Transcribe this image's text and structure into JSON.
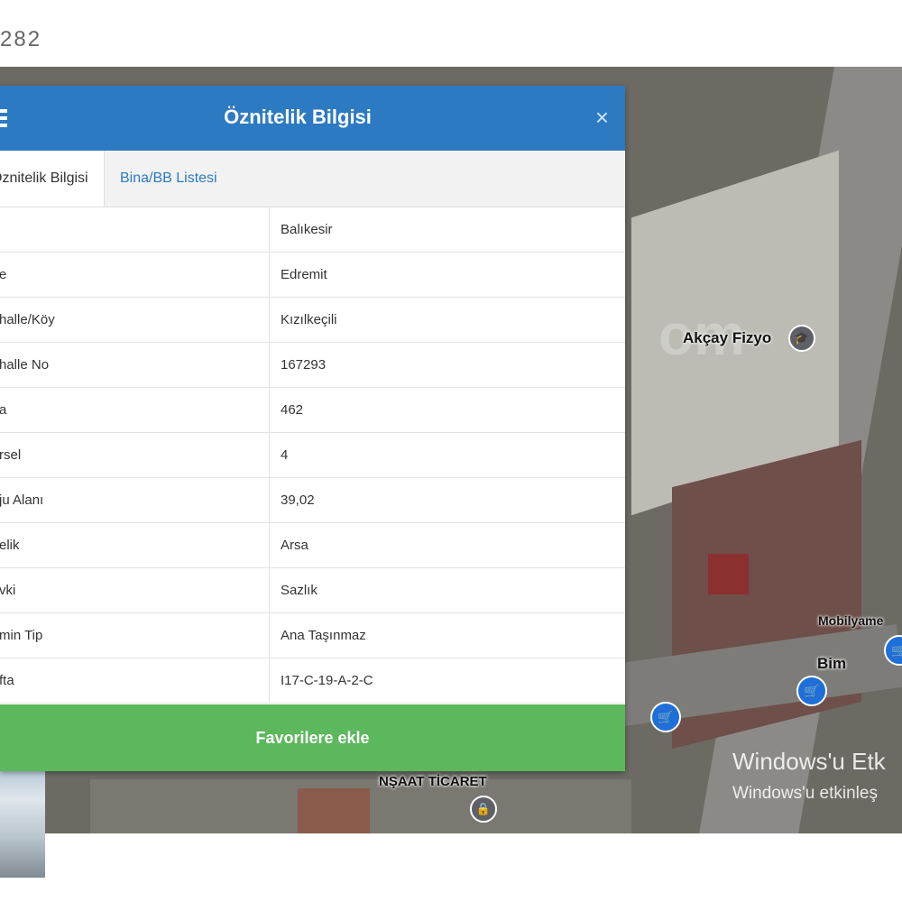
{
  "page": {
    "top_number": "282"
  },
  "dialog": {
    "title": "Öznitelik Bilgisi",
    "close_symbol": "×",
    "tabs": [
      {
        "label": "Öznitelik Bilgisi",
        "active": true
      },
      {
        "label": "Bina/BB Listesi",
        "active": false
      }
    ],
    "rows": [
      {
        "key": "",
        "value": "Balıkesir"
      },
      {
        "key": "e",
        "value": "Edremit"
      },
      {
        "key": "halle/Köy",
        "value": "Kızılkeçili"
      },
      {
        "key": "halle No",
        "value": "167293"
      },
      {
        "key": "a",
        "value": "462"
      },
      {
        "key": "rsel",
        "value": "4"
      },
      {
        "key": "ju Alanı",
        "value": "39,02"
      },
      {
        "key": "elik",
        "value": "Arsa"
      },
      {
        "key": "vki",
        "value": "Sazlık"
      },
      {
        "key": "min Tip",
        "value": "Ana Taşınmaz"
      },
      {
        "key": "fta",
        "value": "I17-C-19-A-2-C"
      }
    ],
    "favorite_button": "Favorilere ekle"
  },
  "map": {
    "labels": {
      "akcay": "Akçay Fizyo",
      "mobilya": "Mobilyame",
      "bim": "Bim",
      "insaat": "NŞAAT TİCARET",
      "watermark": "om"
    },
    "activation": {
      "line1": "Windows'u Etk",
      "line2": "Windows'u etkinleş"
    },
    "pin_color": "#1e6fd9"
  },
  "colors": {
    "header": "#2c7ac1",
    "button": "#5cb85c"
  }
}
